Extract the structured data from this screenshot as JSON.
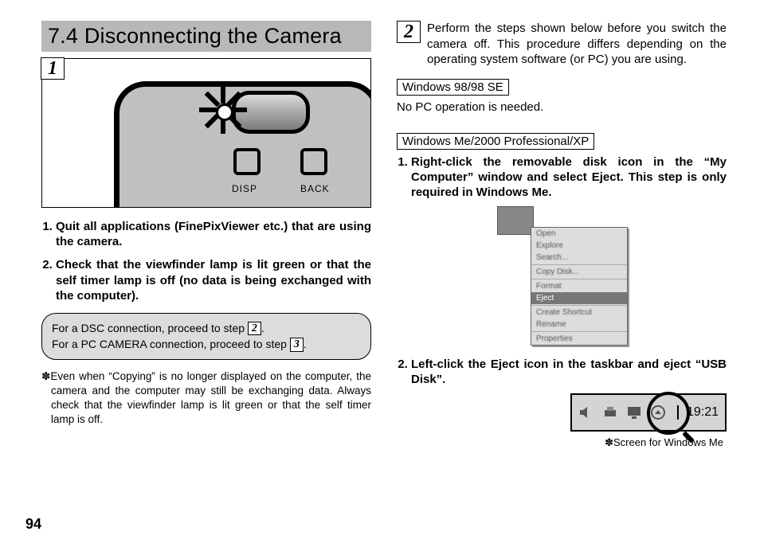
{
  "heading": "7.4 Disconnecting the Camera",
  "step_numbers": {
    "one": "1",
    "two": "2",
    "box2": "2",
    "box3": "3"
  },
  "left": {
    "illus_labels": {
      "disp": "DISP",
      "back": "BACK"
    },
    "list": [
      "Quit all applications (FinePixViewer etc.) that are using the camera.",
      "Check that the viewfinder lamp is lit green or that the self timer lamp is off (no data is being exchanged with the computer)."
    ],
    "info_line1_a": "For a DSC connection, proceed to step ",
    "info_line1_b": ".",
    "info_line2_a": "For a PC CAMERA connection, proceed to step ",
    "info_line2_b": ".",
    "note": "Even when “Copying” is no longer displayed on the computer, the camera and the computer may still be exchanging data. Always check that the viewfinder lamp is lit green or that the self timer lamp is off."
  },
  "right": {
    "intro": "Perform the steps shown below before you switch the camera off. This procedure differs depending on the operating system software (or PC) you are using.",
    "os1": "Windows 98/98 SE",
    "os1_text": "No PC operation is needed.",
    "os2": "Windows Me/2000 Professional/XP",
    "list": [
      "Right-click the removable disk icon in the “My Computer” window and select Eject. This step is only required in Windows Me.",
      "Left-click the Eject icon in the taskbar and eject “USB Disk”."
    ],
    "menu_items": [
      "Open",
      "Explore",
      "Search...",
      "",
      "Copy Disk...",
      "",
      "Format",
      "Eject",
      "",
      "Create Shortcut",
      "Rename",
      "",
      "Properties"
    ],
    "tray_time": "19:21",
    "caption": "Screen for Windows Me"
  },
  "page_number": "94",
  "asterisk": "✽"
}
